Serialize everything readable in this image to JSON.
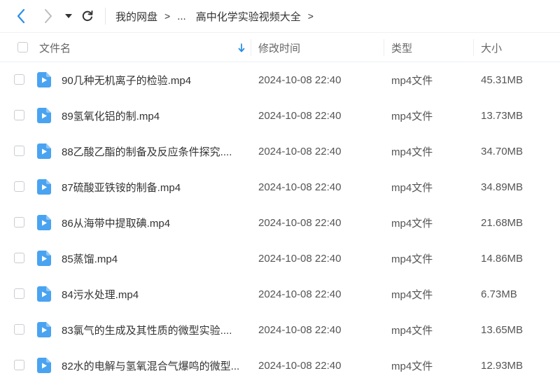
{
  "toolbar": {
    "back_icon": "chevron-left-icon",
    "forward_icon": "chevron-right-icon",
    "dropdown_icon": "caret-down-icon",
    "refresh_icon": "refresh-icon"
  },
  "breadcrumb": {
    "root": "我的网盘",
    "ellipsis": "...",
    "current": "高中化学实验视频大全",
    "separator": ">"
  },
  "columns": {
    "name": "文件名",
    "modified": "修改时间",
    "type": "类型",
    "size": "大小",
    "sort_icon": "sort-down-arrow-icon"
  },
  "colors": {
    "accent": "#2b8fe8",
    "file_icon": "#4aa3f0",
    "text": "#333333",
    "muted": "#666666"
  },
  "files": [
    {
      "name": "90几种无机离子的检验.mp4",
      "modified": "2024-10-08 22:40",
      "type": "mp4文件",
      "size": "45.31MB"
    },
    {
      "name": "89氢氧化铝的制.mp4",
      "modified": "2024-10-08 22:40",
      "type": "mp4文件",
      "size": "13.73MB"
    },
    {
      "name": "88乙酸乙酯的制备及反应条件探究....",
      "modified": "2024-10-08 22:40",
      "type": "mp4文件",
      "size": "34.70MB"
    },
    {
      "name": "87硫酸亚铁铵的制备.mp4",
      "modified": "2024-10-08 22:40",
      "type": "mp4文件",
      "size": "34.89MB"
    },
    {
      "name": "86从海带中提取碘.mp4",
      "modified": "2024-10-08 22:40",
      "type": "mp4文件",
      "size": "21.68MB"
    },
    {
      "name": "85蒸馏.mp4",
      "modified": "2024-10-08 22:40",
      "type": "mp4文件",
      "size": "14.86MB"
    },
    {
      "name": "84污水处理.mp4",
      "modified": "2024-10-08 22:40",
      "type": "mp4文件",
      "size": "6.73MB"
    },
    {
      "name": "83氯气的生成及其性质的微型实验....",
      "modified": "2024-10-08 22:40",
      "type": "mp4文件",
      "size": "13.65MB"
    },
    {
      "name": "82水的电解与氢氧混合气爆鸣的微型...",
      "modified": "2024-10-08 22:40",
      "type": "mp4文件",
      "size": "12.93MB"
    }
  ]
}
